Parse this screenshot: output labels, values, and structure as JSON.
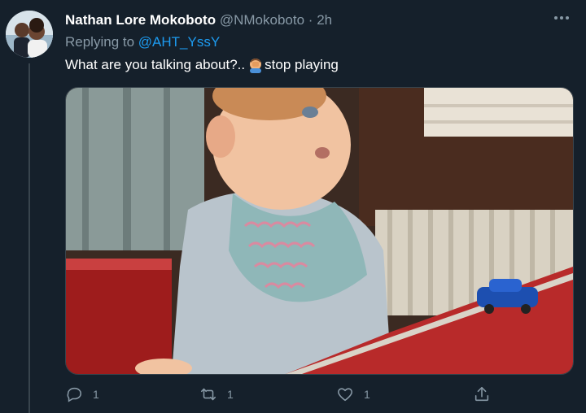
{
  "tweet": {
    "display_name": "Nathan Lore Mokoboto",
    "handle": "@NMokoboto",
    "separator": "·",
    "time": "2h",
    "replying_prefix": "Replying to",
    "replying_to": "@AHT_YssY",
    "text_before_emoji": "What are you talking about?..",
    "emoji": "person-facepalming",
    "text_after_emoji": "stop playing",
    "more_label": "···"
  },
  "actions": {
    "reply_count": "1",
    "retweet_count": "1",
    "like_count": "1"
  },
  "media": {
    "description_icon": "baby-video-thumbnail"
  },
  "colors": {
    "background": "#15202b",
    "secondary_text": "#8899a6",
    "accent": "#1d9bf0",
    "border": "#38444d"
  }
}
